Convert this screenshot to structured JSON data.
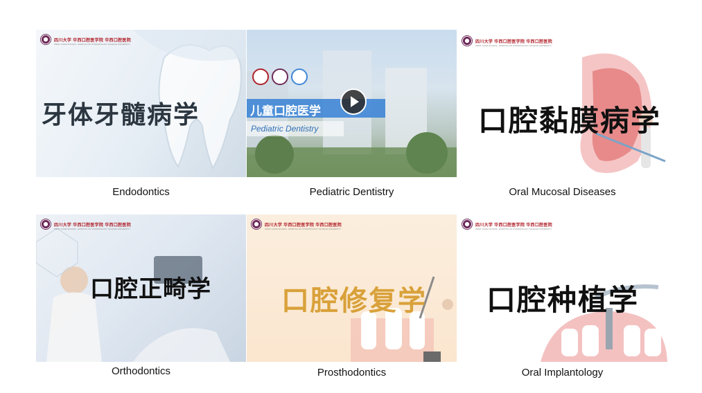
{
  "header": {
    "logo_text": "四川大学 华西口腔医学院 华西口腔医院",
    "logo_sub": "WEST CHINA SCHOOL, HOSPITAL OF STOMATOLOGY SICHUAN UNIVERSITY"
  },
  "courses": [
    {
      "title_cn": "牙体牙髓病学",
      "subtitle": "",
      "caption": "Endodontics"
    },
    {
      "title_cn": "儿童口腔医学",
      "subtitle": "Pediatric Dentistry",
      "caption": "Pediatric Dentistry"
    },
    {
      "title_cn": "口腔黏膜病学",
      "subtitle": "",
      "caption": "Oral Mucosal Diseases"
    },
    {
      "title_cn": "口腔正畸学",
      "subtitle": "",
      "caption": "Orthodontics"
    },
    {
      "title_cn": "口腔修复学",
      "subtitle": "",
      "caption": "Prosthodontics"
    },
    {
      "title_cn": "口腔种植学",
      "subtitle": "",
      "caption": "Oral Implantology"
    }
  ],
  "colors": {
    "logo_red": "#b0212a",
    "seal_purple": "#6e2b5a",
    "pediatric_banner": "#3f86d6",
    "prostho_title": "#d9a13a"
  },
  "icons": {
    "play": "play-icon"
  }
}
